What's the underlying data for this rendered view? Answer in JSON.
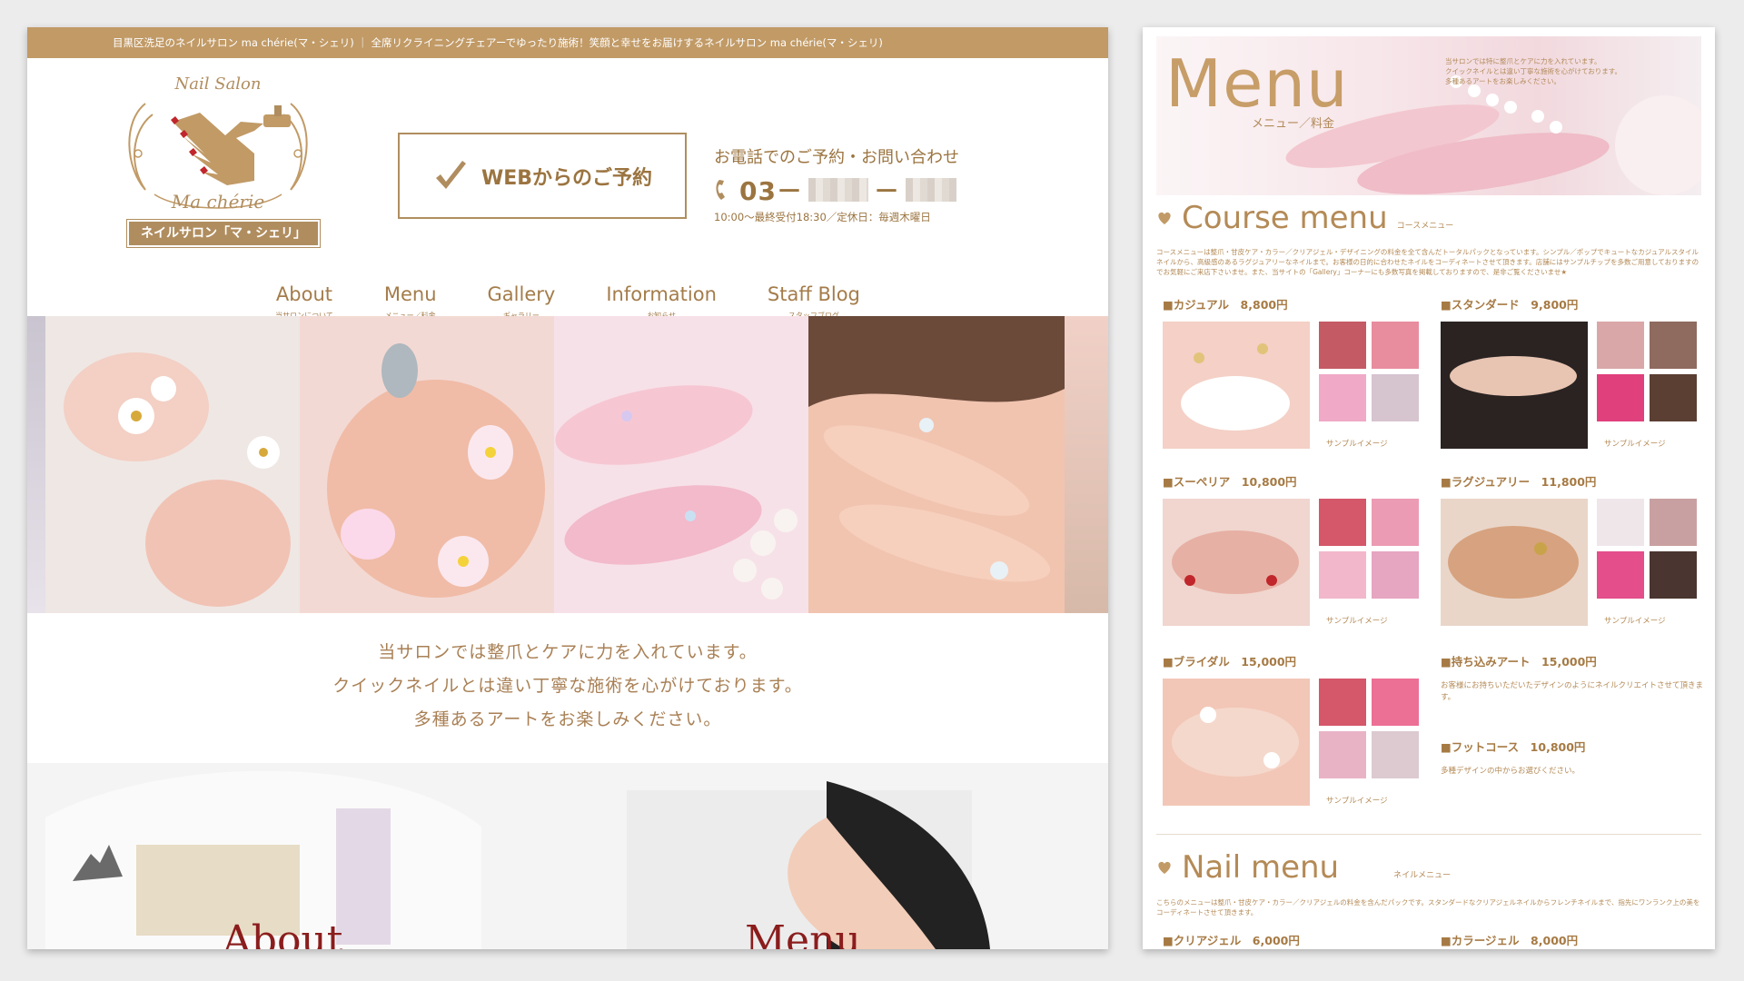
{
  "site": {
    "topbar_text": "目黒区洗足のネイルサロン ma chérie(マ・シェリ) ｜ 全席リクライニングチェアーでゆったり施術！笑顔と幸せをお届けするネイルサロン ma chérie(マ・シェリ)",
    "logo": {
      "script_top": "Nail Salon",
      "script_bottom": "Ma chérie",
      "badge": "ネイルサロン「マ・シェリ」"
    },
    "reserve_button": "WEBからのご予約",
    "phone": {
      "caption": "お電話でのご予約・お問い合わせ",
      "prefix": "03－",
      "separator": "－",
      "hours": "10:00〜最終受付18:30／定休日：毎週木曜日"
    },
    "nav": [
      {
        "label": "About",
        "sub": "当サロンについて"
      },
      {
        "label": "Menu",
        "sub": "メニュー／料金"
      },
      {
        "label": "Gallery",
        "sub": "ギャラリー"
      },
      {
        "label": "Information",
        "sub": "お知らせ"
      },
      {
        "label": "Staff Blog",
        "sub": "スタッフブログ"
      }
    ],
    "intro": [
      "当サロンでは整爪とケアに力を入れています。",
      "クイックネイルとは違い丁寧な施術を心がけております。",
      "多種あるアートをお楽しみください。"
    ],
    "tiles": {
      "left": "About",
      "right": "Menu"
    }
  },
  "menu_page": {
    "title": "Menu",
    "subtitle": "メニュー／料金",
    "hero_note": "当サロンでは特に整爪とケアに力を入れています。\nクイックネイルとは違い丁寧な施術を心がけております。\n多種あるアートをお楽しみください。",
    "course_section": {
      "title": "Course menu",
      "sub": "コースメニュー",
      "desc": "コースメニューは整爪・甘皮ケア・カラー／クリアジェル・デザイニングの料金を全て含んだトータルパックとなっています。シンプル／ポップでキュートなカジュアルスタイルネイルから、高級感のあるラグジュアリーなネイルまで。お客様の日的に合わせたネイルをコーディネートさせて頂きます。店舗にはサンプルチップを多数ご用意しておりますのでお気軽にご来店下さいませ。また、当サイトの「Gallery」コーナーにも多数写真を掲載しておりますので、是非ご覧くださいませ★"
    },
    "courses": [
      {
        "name": "■カジュアル　8,800円",
        "caption": "サンプルイメージ"
      },
      {
        "name": "■スタンダード　9,800円",
        "caption": "サンプルイメージ"
      },
      {
        "name": "■スーペリア　10,800円",
        "caption": "サンプルイメージ"
      },
      {
        "name": "■ラグジュアリー　11,800円",
        "caption": "サンプルイメージ"
      },
      {
        "name": "■ブライダル　15,000円",
        "caption": "サンプルイメージ"
      }
    ],
    "extra": [
      {
        "name": "■持ち込みアート　15,000円",
        "text": "お客様にお持ちいただいたデザインのようにネイルクリエイトさせて頂きます。"
      },
      {
        "name": "■フットコース　10,800円",
        "text": "多種デザインの中からお選びください。"
      }
    ],
    "nail_section": {
      "title": "Nail menu",
      "sub": "ネイルメニュー",
      "desc": "こちらのメニューは整爪・甘皮ケア・カラー／クリアジェルの料金を含んだパックです。スタンダードなクリアジェルネイルからフレンチネイルまで、指先にワンランク上の美をコーディネートさせて頂きます。"
    },
    "nail_items": [
      "■クリアジェル　6,000円",
      "■カラージェル　8,000円"
    ]
  },
  "colors": {
    "accent": "#c19a66",
    "text": "#a47c4a",
    "tile_text": "#8b1d1d"
  }
}
